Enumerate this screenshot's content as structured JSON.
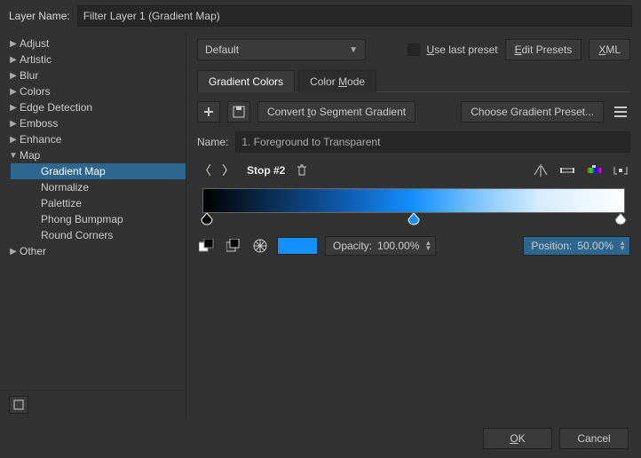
{
  "header": {
    "label": "Layer Name:",
    "value": "Filter Layer 1 (Gradient Map)"
  },
  "tree": {
    "items": [
      "Adjust",
      "Artistic",
      "Blur",
      "Colors",
      "Edge Detection",
      "Emboss",
      "Enhance",
      "Map",
      "Other"
    ],
    "mapChildren": [
      "Gradient Map",
      "Normalize",
      "Palettize",
      "Phong Bumpmap",
      "Round Corners"
    ]
  },
  "topRow": {
    "preset": "Default",
    "useLastPreset": "Use last preset",
    "editPresets": "Edit Presets",
    "xml": "XML"
  },
  "tabs": {
    "gradientColors": "Gradient Colors",
    "colorMode": "Color Mode"
  },
  "toolbar": {
    "convert": "Convert to Segment Gradient",
    "choose": "Choose Gradient Preset..."
  },
  "nameRow": {
    "label": "Name:",
    "value": "1. Foreground to Transparent"
  },
  "stopRow": {
    "label": "Stop #2"
  },
  "controls": {
    "swatchColor": "#1490ff",
    "opacityLabel": "Opacity:",
    "opacityValue": "100.00%",
    "positionLabel": "Position:",
    "positionValue": "50.00%"
  },
  "footer": {
    "ok": "OK",
    "cancel": "Cancel"
  }
}
